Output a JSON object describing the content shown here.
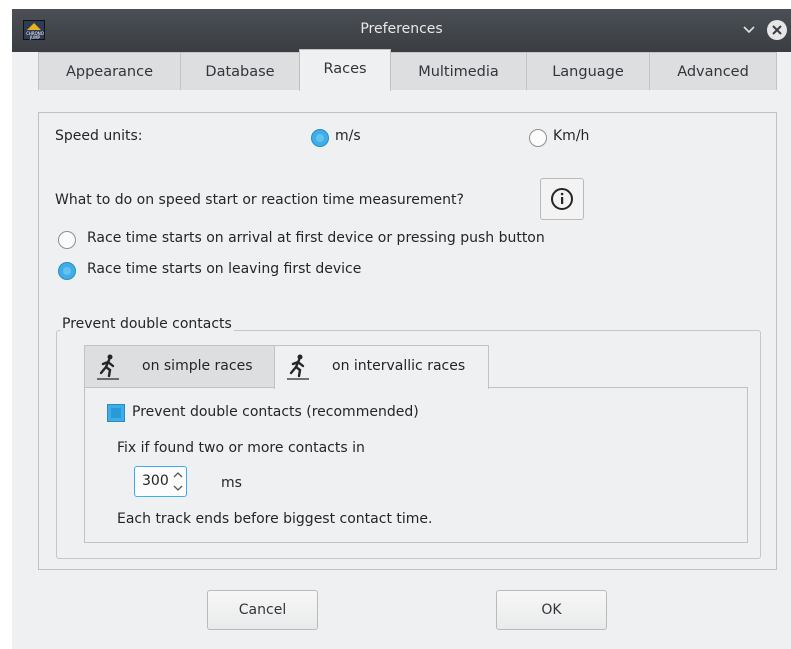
{
  "window": {
    "title": "Preferences",
    "logo_text": "CHRONO JUMP"
  },
  "tabs": [
    {
      "label": "Appearance"
    },
    {
      "label": "Database"
    },
    {
      "label": "Races",
      "active": true
    },
    {
      "label": "Multimedia"
    },
    {
      "label": "Language"
    },
    {
      "label": "Advanced"
    }
  ],
  "races": {
    "speed_units_label": "Speed units:",
    "unit_ms": "m/s",
    "unit_kmh": "Km/h",
    "selected_unit": "m/s",
    "question": "What to do on speed start or reaction time measurement?",
    "option_arrival": "Race time starts on arrival at first device or pressing push button",
    "option_leaving": "Race time starts on leaving first device",
    "selected_option": "leaving",
    "double_contacts": {
      "group_title": "Prevent double contacts",
      "subtabs": [
        {
          "label": "on simple races",
          "icon": "runner-icon"
        },
        {
          "label": "on intervallic races",
          "icon": "runner-icon",
          "active": true
        }
      ],
      "checkbox_label": "Prevent double contacts (recommended)",
      "checkbox_checked": true,
      "fix_label": "Fix if found two or more contacts in",
      "spin_value": "300",
      "spin_unit": "ms",
      "note": "Each track ends before biggest contact time."
    }
  },
  "buttons": {
    "cancel": "Cancel",
    "ok": "OK"
  },
  "colors": {
    "accent": "#3daee9",
    "background": "#eff0f1",
    "titlebar": "#3f4348"
  }
}
